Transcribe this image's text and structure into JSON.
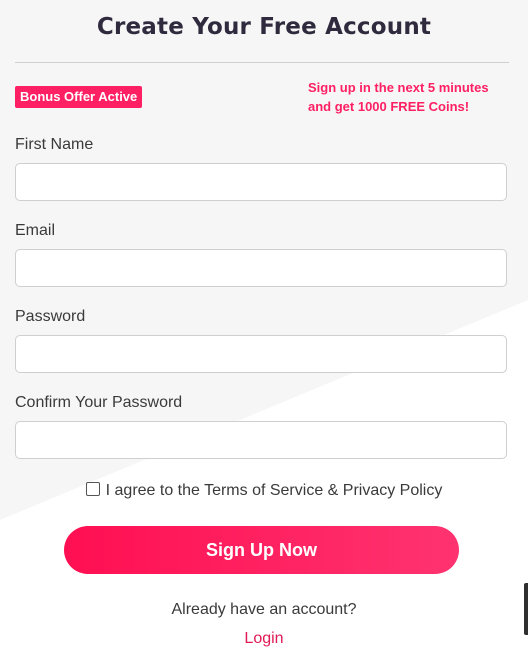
{
  "form": {
    "title": "Create Your Free Account",
    "badge": "Bonus Offer Active",
    "promo_line1": "Sign up in the next 5 minutes",
    "promo_line2": "and get 1000 FREE Coins!",
    "fields": [
      {
        "label": "First Name",
        "value": "",
        "placeholder": ""
      },
      {
        "label": "Email",
        "value": "",
        "placeholder": ""
      },
      {
        "label": "Password",
        "value": "",
        "placeholder": ""
      },
      {
        "label": "Confirm Your Password",
        "value": "",
        "placeholder": ""
      }
    ],
    "agree_text": "I agree to the Terms of Service & Privacy Policy",
    "agree_checked": false,
    "submit_label": "Sign Up Now",
    "already_text": "Already have an account?",
    "login_label": "Login"
  },
  "colors": {
    "accent": "#ff1f63",
    "text": "#3a3a3a",
    "title": "#2f2a3d"
  }
}
